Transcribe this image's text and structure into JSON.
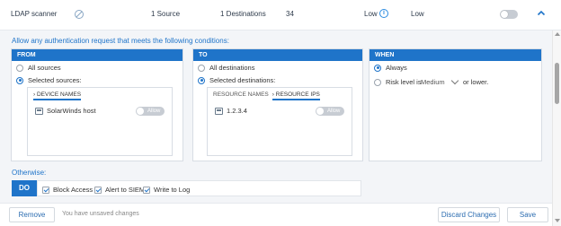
{
  "rule_row": {
    "name": "LDAP scanner",
    "source_count": "1 Source",
    "destination_count": "1 Destinations",
    "count": "34",
    "risk": "Low",
    "level": "Low",
    "enabled": false
  },
  "intro": "Allow any authentication request that meets the following conditions:",
  "from": {
    "header": "FROM",
    "option_all": "All sources",
    "option_selected": "Selected sources:",
    "tab": "DEVICE NAMES",
    "item": "SolarWinds host",
    "toggle_label": "Allow"
  },
  "to": {
    "header": "TO",
    "option_all": "All destinations",
    "option_selected": "Selected destinations:",
    "tabs": [
      "RESOURCE NAMES",
      "RESOURCE IPS"
    ],
    "item": "1.2.3.4",
    "toggle_label": "Allow"
  },
  "when": {
    "header": "WHEN",
    "option_always": "Always",
    "option_risk": "Risk level is",
    "risk_value": "Medium",
    "suffix": "or lower."
  },
  "otherwise": {
    "label": "Otherwise:",
    "badge": "DO",
    "actions": [
      "Block Access",
      "Alert to SIEM",
      "Write to Log"
    ]
  },
  "footer": {
    "remove": "Remove",
    "unsaved": "You have unsaved changes",
    "discard": "Discard Changes",
    "save": "Save"
  },
  "colors": {
    "accent": "#1f74c9"
  }
}
